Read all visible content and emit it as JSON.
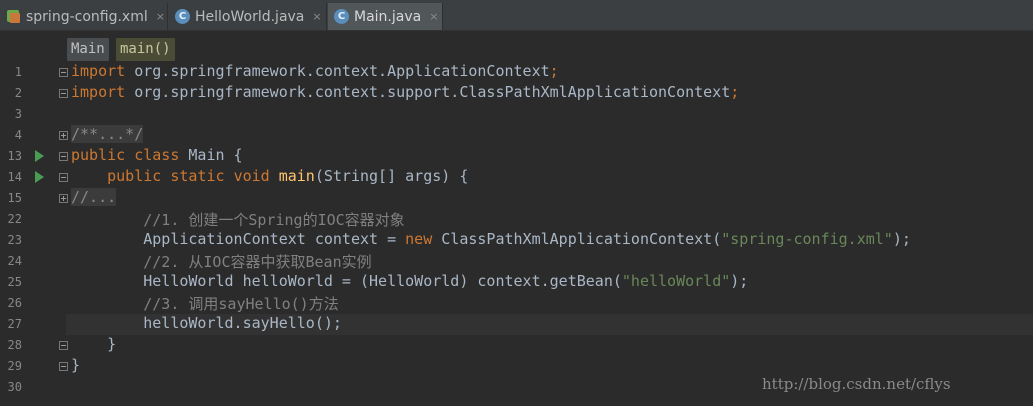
{
  "tabs": [
    {
      "label": "spring-config.xml",
      "icon": "xml-file-icon",
      "active": false
    },
    {
      "label": "HelloWorld.java",
      "icon": "java-class-icon",
      "active": false
    },
    {
      "label": "Main.java",
      "icon": "java-class-icon",
      "active": true
    }
  ],
  "tab_close_glyph": "×",
  "breadcrumb": {
    "class_name": "Main",
    "method_name": "main()"
  },
  "lines": [
    {
      "n": "1",
      "text": "import org.springframework.context.ApplicationContext;"
    },
    {
      "n": "2",
      "text": "import org.springframework.context.support.ClassPathXmlApplicationContext;"
    },
    {
      "n": "3",
      "text": ""
    },
    {
      "n": "4",
      "text": "/**...*/"
    },
    {
      "n": "13",
      "text": "public class Main {"
    },
    {
      "n": "14",
      "text": "    public static void main(String[] args) {"
    },
    {
      "n": "15",
      "text": "//..."
    },
    {
      "n": "22",
      "text": "        //1. 创建一个Spring的IOC容器对象"
    },
    {
      "n": "23",
      "text": "        ApplicationContext context = new ClassPathXmlApplicationContext(\"spring-config.xml\");"
    },
    {
      "n": "24",
      "text": "        //2. 从IOC容器中获取Bean实例"
    },
    {
      "n": "25",
      "text": "        HelloWorld helloWorld = (HelloWorld) context.getBean(\"helloWorld\");"
    },
    {
      "n": "26",
      "text": "        //3. 调用sayHello()方法"
    },
    {
      "n": "27",
      "text": "        helloWorld.sayHello();"
    },
    {
      "n": "28",
      "text": "    }"
    },
    {
      "n": "29",
      "text": "}"
    },
    {
      "n": "30",
      "text": ""
    }
  ],
  "tokens": {
    "import": "import",
    "pkg1": " org.springframework.context.ApplicationContext",
    "pkg2": " org.springframework.context.support.ClassPathXmlApplicationContext",
    "semi": ";",
    "javadoc_fold": "/**...*/",
    "public": "public",
    "class": "class",
    "class_name": " Main {",
    "static": "static",
    "void": "void",
    "main": "main",
    "main_args": "(String[] args) {",
    "comment_fold": "//...",
    "c1": "//1. 创建一个Spring的IOC容器对象",
    "l23a": "ApplicationContext context = ",
    "new": "new",
    "l23b": " ClassPathXmlApplicationContext(",
    "s23": "\"spring-config.xml\"",
    "l23c": ");",
    "c2": "//2. 从IOC容器中获取Bean实例",
    "l25a": "HelloWorld helloWorld = (HelloWorld) context.getBean(",
    "s25": "\"helloWorld\"",
    "l25c": ");",
    "c3": "//3. 调用sayHello()方法",
    "l27": "helloWorld.sayHello();",
    "close_method": "}",
    "close_class": "}"
  },
  "colors": {
    "background": "#2b2b2b",
    "keyword": "#cc7832",
    "string": "#6a8759",
    "comment": "#808080",
    "method_name": "#ffc66d",
    "plain": "#a9b7c6"
  },
  "watermark": "http://blog.csdn.net/cflys"
}
